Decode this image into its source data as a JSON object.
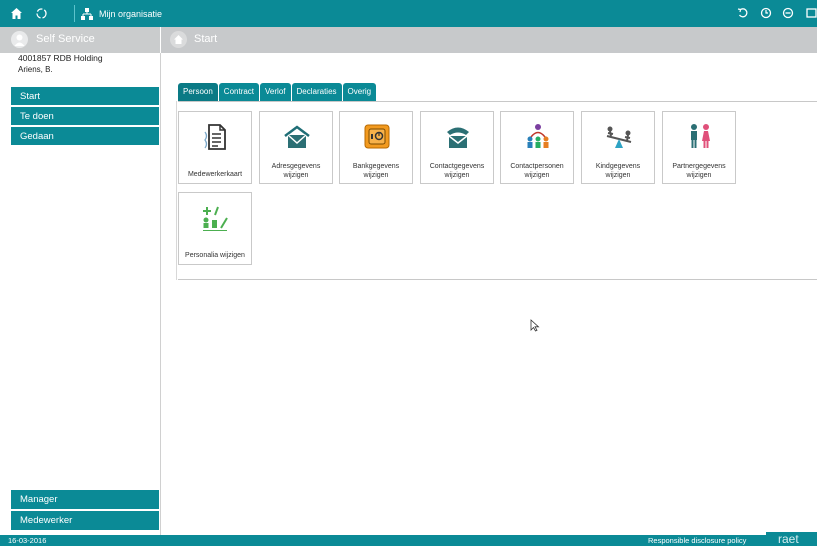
{
  "topbar": {
    "org_label": "Mijn organisatie",
    "icons": [
      "home-icon",
      "refresh-icon",
      "organisation-icon",
      "undo-icon",
      "history-icon",
      "logout-icon",
      "window-icon"
    ]
  },
  "header": {
    "app_title": "Self Service",
    "breadcrumb": "Start"
  },
  "employee": {
    "company": "4001857 RDB Holding",
    "name": "Ariens, B."
  },
  "sidebar": {
    "items": [
      {
        "label": "Start"
      },
      {
        "label": "Te doen"
      },
      {
        "label": "Gedaan"
      }
    ],
    "bottom_items": [
      {
        "label": "Manager"
      },
      {
        "label": "Medewerker"
      }
    ]
  },
  "tabs": [
    {
      "label": "Persoon"
    },
    {
      "label": "Contract"
    },
    {
      "label": "Verlof"
    },
    {
      "label": "Declaraties"
    },
    {
      "label": "Overig"
    }
  ],
  "tiles": [
    {
      "label": "Medewerkerkaart",
      "icon": "document-icon"
    },
    {
      "label": "Adresgegevens wijzigen",
      "icon": "house-envelope-icon"
    },
    {
      "label": "Bankgegevens wijzigen",
      "icon": "safe-icon"
    },
    {
      "label": "Contactgegevens wijzigen",
      "icon": "phone-envelope-icon"
    },
    {
      "label": "Contactpersonen wijzigen",
      "icon": "people-network-icon"
    },
    {
      "label": "Kindgegevens wijzigen",
      "icon": "seesaw-icon"
    },
    {
      "label": "Partnergegevens wijzigen",
      "icon": "couple-icon"
    },
    {
      "label": "Personalia wijzigen",
      "icon": "personalia-edit-icon"
    }
  ],
  "statusbar": {
    "date": "16-03-2016",
    "policy_link": "Responsible disclosure policy",
    "logo": "raet"
  },
  "colors": {
    "accent": "#0b8a96",
    "header_gray": "#c7c9cb"
  }
}
